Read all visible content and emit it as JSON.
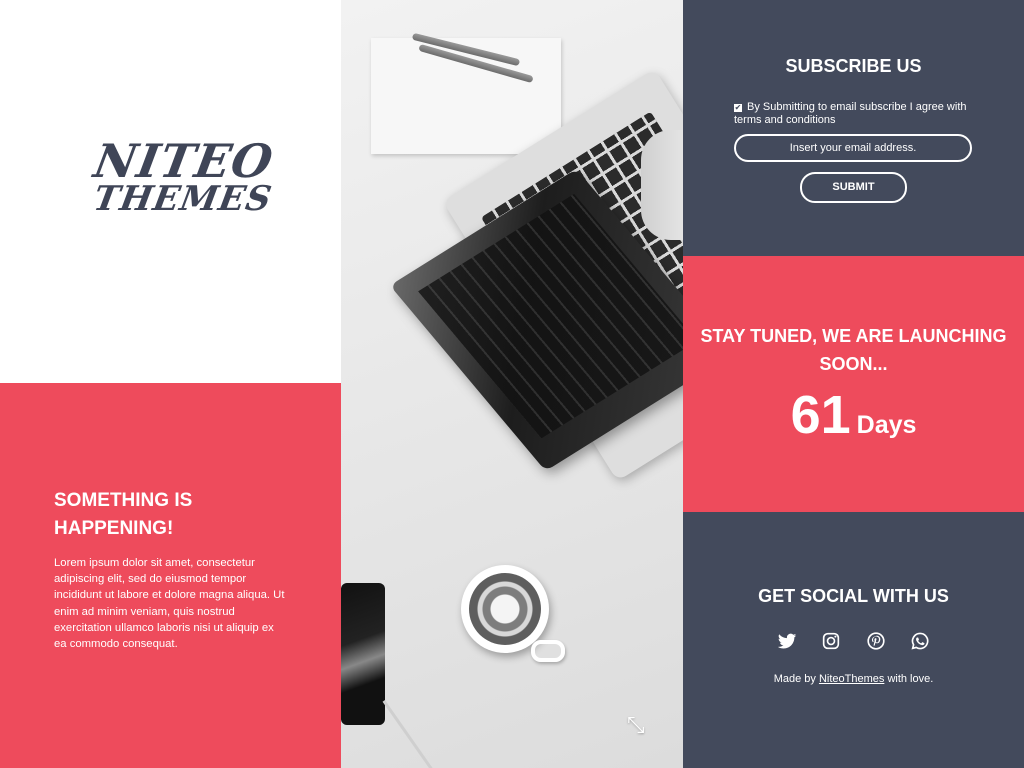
{
  "logo": {
    "line1": "NITEO",
    "line2": "THEMES"
  },
  "intro": {
    "heading": "SOMETHING IS HAPPENING!",
    "body": "Lorem ipsum dolor sit amet, consectetur adipiscing elit, sed do eiusmod tempor incididunt ut labore et dolore magna aliqua. Ut enim ad minim veniam, quis nostrud exercitation ullamco laboris nisi ut aliquip ex ea commodo consequat."
  },
  "subscribe": {
    "heading": "SUBSCRIBE US",
    "agree_text": "By Submitting to email subscribe I agree with terms and conditions",
    "agree_checked": true,
    "email_placeholder": "Insert your email address.",
    "submit_label": "SUBMIT"
  },
  "countdown": {
    "heading": "STAY TUNED, WE ARE LAUNCHING SOON...",
    "value": "61",
    "unit": "Days"
  },
  "social": {
    "heading": "GET SOCIAL WITH US",
    "icons": [
      "twitter-icon",
      "instagram-icon",
      "pinterest-icon",
      "whatsapp-icon"
    ],
    "credit_prefix": "Made by",
    "credit_link": "NiteoThemes",
    "credit_suffix": "with love."
  },
  "colors": {
    "accent": "#ee4b5c",
    "dark": "#434a5c",
    "logo": "#3f4557"
  },
  "photo": {
    "expand_icon": "expand-icon"
  }
}
